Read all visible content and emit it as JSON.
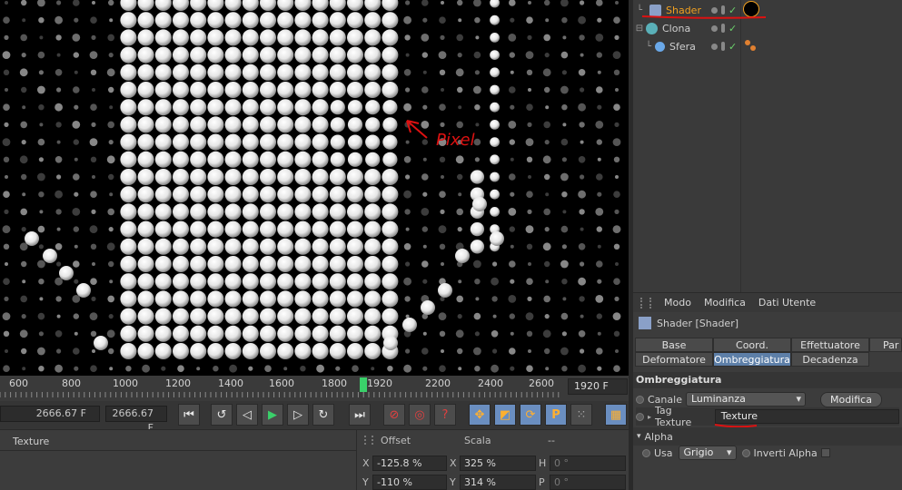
{
  "viewport": {
    "annotation": "Pixel"
  },
  "object_manager": {
    "objects": [
      {
        "name": "Shader",
        "selected": true
      },
      {
        "name": "Clona",
        "selected": false
      },
      {
        "name": "Sfera",
        "selected": false
      }
    ]
  },
  "attributes": {
    "menu": [
      "Modo",
      "Modifica",
      "Dati Utente"
    ],
    "title": "Shader [Shader]",
    "tabs_row1": [
      "Base",
      "Coord.",
      "Effettuatore",
      "Par"
    ],
    "tabs_row2": [
      "Deformatore",
      "Ombreggiatura",
      "Decadenza"
    ],
    "active_tab": "Ombreggiatura",
    "section": "Ombreggiatura",
    "canale_label": "Canale",
    "canale_value": "Luminanza",
    "modifica_button": "Modifica",
    "tag_texture_label": "Tag Texture",
    "tag_texture_value": "Texture",
    "alpha_group": "Alpha",
    "usa_label": "Usa",
    "usa_value": "Grigio",
    "inverti_alpha_label": "Inverti Alpha"
  },
  "timeline": {
    "ticks": [
      "600",
      "800",
      "1000",
      "1200",
      "1400",
      "1600",
      "1800",
      "1920",
      "2200",
      "2400",
      "2600"
    ],
    "current_frame": "1920 F"
  },
  "transport": {
    "end_frame": "2666.67 F",
    "preview_end": "2666.67 F"
  },
  "material_panel": {
    "header": "Texture"
  },
  "coordinates": {
    "col_offset": "Offset",
    "col_scala": "Scala",
    "col_third": "--",
    "rows": [
      {
        "axis": "X",
        "offset": "-125.8 %",
        "saxis": "X",
        "scala": "325 %",
        "raxis": "H",
        "rot": "0 °"
      },
      {
        "axis": "Y",
        "offset": "-110 %",
        "saxis": "Y",
        "scala": "314 %",
        "raxis": "P",
        "rot": "0 °"
      }
    ]
  },
  "colors": {
    "accent_blue": "#5d7fa8",
    "annotation_red": "#dd1111",
    "selected_orange": "#f0a020"
  }
}
